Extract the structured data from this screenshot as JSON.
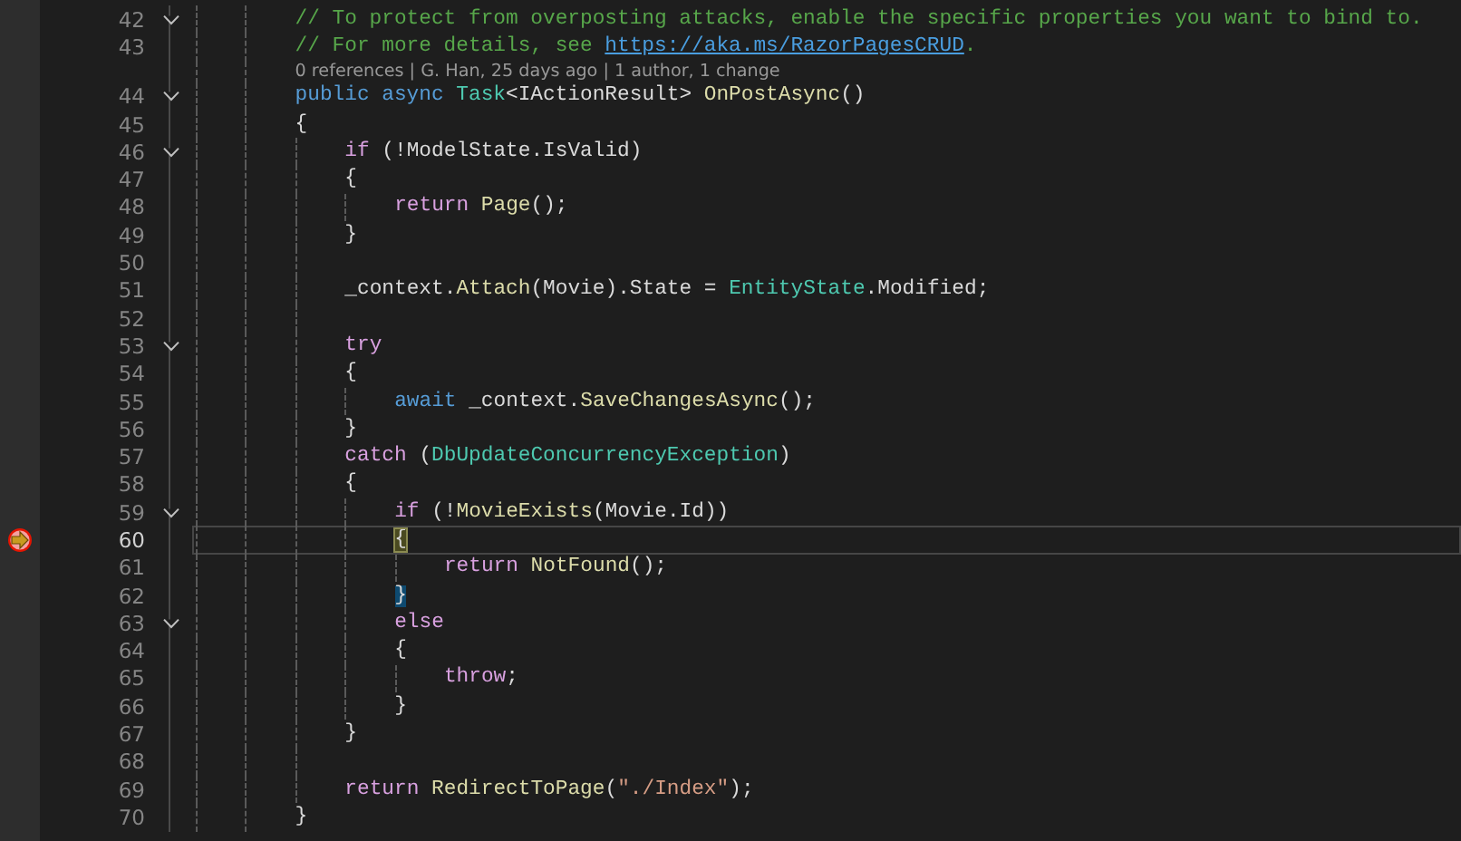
{
  "editor": {
    "lines": [
      {
        "number": "42",
        "fold": true,
        "tokens": [
          {
            "text": "// To protect from overposting attacks, enable the specific properties you want to bind to.",
            "kind": "comment"
          }
        ]
      },
      {
        "number": "43",
        "tokens": [
          {
            "text": "// For more details, see ",
            "kind": "comment"
          },
          {
            "text": "https://aka.ms/RazorPagesCRUD",
            "kind": "link"
          },
          {
            "text": ".",
            "kind": "comment"
          }
        ]
      },
      {
        "codelens": "0 references | G. Han, 25 days ago | 1 author, 1 change"
      },
      {
        "number": "44",
        "fold": true,
        "tokens": [
          {
            "text": "public",
            "kind": "keyword"
          },
          {
            "text": " async",
            "kind": "keyword"
          },
          {
            "text": " Task",
            "kind": "type"
          },
          {
            "text": "<IActionResult> ",
            "kind": "plain"
          },
          {
            "text": "OnPostAsync",
            "kind": "method"
          },
          {
            "text": "()",
            "kind": "plain"
          }
        ]
      },
      {
        "number": "45",
        "tokens": [
          {
            "text": "{",
            "kind": "plain"
          }
        ],
        "children": [
          {
            "number": "46",
            "fold": true,
            "tokens": [
              {
                "text": "if",
                "kind": "control"
              },
              {
                "text": " (!ModelState.IsValid)",
                "kind": "plain"
              }
            ]
          },
          {
            "number": "47",
            "tokens": [
              {
                "text": "{",
                "kind": "plain"
              }
            ],
            "children": [
              {
                "number": "48",
                "tokens": [
                  {
                    "text": "return",
                    "kind": "control"
                  },
                  {
                    "text": " Page",
                    "kind": "method"
                  },
                  {
                    "text": "();",
                    "kind": "plain"
                  }
                ]
              }
            ]
          },
          {
            "number": "49",
            "tokens": [
              {
                "text": "}",
                "kind": "plain"
              }
            ]
          },
          {
            "number": "50"
          },
          {
            "number": "51",
            "tokens": [
              {
                "text": "_context.",
                "kind": "plain"
              },
              {
                "text": "Attach",
                "kind": "method"
              },
              {
                "text": "(Movie).State = ",
                "kind": "plain"
              },
              {
                "text": "EntityState",
                "kind": "type"
              },
              {
                "text": ".Modified;",
                "kind": "plain"
              }
            ]
          },
          {
            "number": "52"
          },
          {
            "number": "53",
            "fold": true,
            "tokens": [
              {
                "text": "try",
                "kind": "control"
              }
            ]
          },
          {
            "number": "54",
            "tokens": [
              {
                "text": "{",
                "kind": "plain"
              }
            ],
            "children": [
              {
                "number": "55",
                "tokens": [
                  {
                    "text": "await",
                    "kind": "keyword"
                  },
                  {
                    "text": " _context.",
                    "kind": "plain"
                  },
                  {
                    "text": "SaveChangesAsync",
                    "kind": "method"
                  },
                  {
                    "text": "();",
                    "kind": "plain"
                  }
                ]
              }
            ]
          },
          {
            "number": "56",
            "tokens": [
              {
                "text": "}",
                "kind": "plain"
              }
            ]
          },
          {
            "number": "57",
            "tokens": [
              {
                "text": "catch",
                "kind": "control"
              },
              {
                "text": " (",
                "kind": "plain"
              },
              {
                "text": "DbUpdateConcurrencyException",
                "kind": "type"
              },
              {
                "text": ")",
                "kind": "plain"
              }
            ]
          },
          {
            "number": "58",
            "tokens": [
              {
                "text": "{",
                "kind": "plain"
              }
            ],
            "children": [
              {
                "number": "59",
                "fold": true,
                "tokens": [
                  {
                    "text": "if",
                    "kind": "control"
                  },
                  {
                    "text": " (!",
                    "kind": "plain"
                  },
                  {
                    "text": "MovieExists",
                    "kind": "method"
                  },
                  {
                    "text": "(Movie.Id))",
                    "kind": "plain"
                  }
                ]
              },
              {
                "number": "60",
                "current": true,
                "execution_point": true,
                "tokens": [
                  {
                    "text": "{",
                    "kind": "brace-current"
                  }
                ],
                "children": [
                  {
                    "number": "61",
                    "tokens": [
                      {
                        "text": "return",
                        "kind": "control"
                      },
                      {
                        "text": " NotFound",
                        "kind": "method"
                      },
                      {
                        "text": "();",
                        "kind": "plain"
                      }
                    ]
                  }
                ]
              },
              {
                "number": "62",
                "tokens": [
                  {
                    "text": "}",
                    "kind": "brace-match"
                  }
                ]
              },
              {
                "number": "63",
                "fold": true,
                "tokens": [
                  {
                    "text": "else",
                    "kind": "control"
                  }
                ]
              },
              {
                "number": "64",
                "tokens": [
                  {
                    "text": "{",
                    "kind": "plain"
                  }
                ],
                "children": [
                  {
                    "number": "65",
                    "tokens": [
                      {
                        "text": "throw",
                        "kind": "control"
                      },
                      {
                        "text": ";",
                        "kind": "plain"
                      }
                    ]
                  }
                ]
              },
              {
                "number": "66",
                "tokens": [
                  {
                    "text": "}",
                    "kind": "plain"
                  }
                ]
              }
            ]
          },
          {
            "number": "67",
            "tokens": [
              {
                "text": "}",
                "kind": "plain"
              }
            ]
          },
          {
            "number": "68"
          },
          {
            "number": "69",
            "tokens": [
              {
                "text": "return",
                "kind": "control"
              },
              {
                "text": " RedirectToPage",
                "kind": "method"
              },
              {
                "text": "(",
                "kind": "plain"
              },
              {
                "text": "\"./Index\"",
                "kind": "string"
              },
              {
                "text": ");",
                "kind": "plain"
              }
            ]
          }
        ]
      },
      {
        "number": "70",
        "tokens": [
          {
            "text": "}",
            "kind": "plain"
          }
        ]
      }
    ]
  }
}
